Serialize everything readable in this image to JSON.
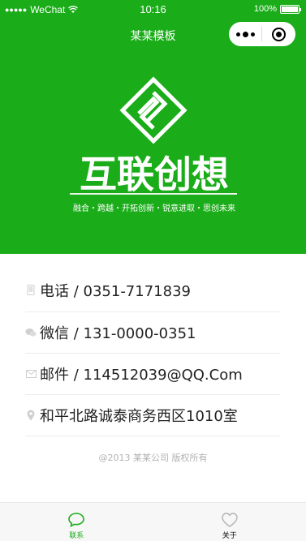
{
  "status_bar": {
    "carrier": "WeChat",
    "time": "10:16",
    "battery": "100%",
    "battery_level": 1.0
  },
  "nav": {
    "title": "某某模板",
    "more_icon": "more-dots-icon",
    "close_icon": "close-ring-icon"
  },
  "banner": {
    "logo_icon": "geometric-logo-icon",
    "logo_text": "互联创想",
    "slogan": "融合・跨越・开拓创新・锐意进取・思创未来",
    "background_color": "#1aad19"
  },
  "contacts": [
    {
      "icon": "phone-icon",
      "text": "电话 / 0351-7171839"
    },
    {
      "icon": "wechat-icon",
      "text": "微信 / 131-0000-0351"
    },
    {
      "icon": "mail-icon",
      "text": "邮件 / 114512039@QQ.Com"
    },
    {
      "icon": "location-icon",
      "text": "和平北路诚泰商务西区1010室"
    }
  ],
  "copyright": "@2013 某某公司 版权所有",
  "tabs": [
    {
      "label": "联系",
      "icon": "chat-bubble-icon",
      "active": true
    },
    {
      "label": "关于",
      "icon": "heart-icon",
      "active": false
    }
  ],
  "colors": {
    "accent": "#1aad19",
    "text": "#222222",
    "muted": "#b2b2b2"
  }
}
